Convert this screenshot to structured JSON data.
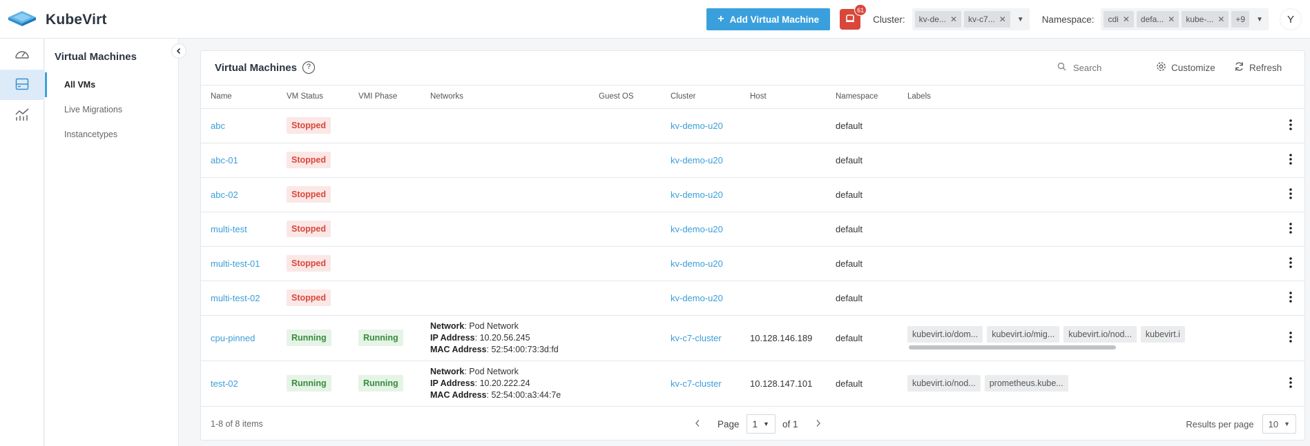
{
  "brand": {
    "name": "KubeVirt"
  },
  "topbar": {
    "add_vm_label": "Add Virtual Machine",
    "alerts_count": "61",
    "cluster_label": "Cluster:",
    "cluster_chips": [
      "kv-de...",
      "kv-c7..."
    ],
    "namespace_label": "Namespace:",
    "namespace_chips": [
      "cdi",
      "defa...",
      "kube-..."
    ],
    "namespace_more": "+9",
    "avatar_initial": "Y"
  },
  "subnav": {
    "title": "Virtual Machines",
    "items": [
      "All VMs",
      "Live Migrations",
      "Instancetypes"
    ]
  },
  "card": {
    "title": "Virtual Machines",
    "search_placeholder": "Search",
    "customize_label": "Customize",
    "refresh_label": "Refresh"
  },
  "table": {
    "columns": [
      "Name",
      "VM Status",
      "VMI Phase",
      "Networks",
      "Guest OS",
      "Cluster",
      "Host",
      "Namespace",
      "Labels"
    ],
    "rows": [
      {
        "name": "abc",
        "vm_status": "Stopped",
        "vmi_phase": "",
        "cluster": "kv-demo-u20",
        "host": "",
        "namespace": "default",
        "labels": []
      },
      {
        "name": "abc-01",
        "vm_status": "Stopped",
        "vmi_phase": "",
        "cluster": "kv-demo-u20",
        "host": "",
        "namespace": "default",
        "labels": []
      },
      {
        "name": "abc-02",
        "vm_status": "Stopped",
        "vmi_phase": "",
        "cluster": "kv-demo-u20",
        "host": "",
        "namespace": "default",
        "labels": []
      },
      {
        "name": "multi-test",
        "vm_status": "Stopped",
        "vmi_phase": "",
        "cluster": "kv-demo-u20",
        "host": "",
        "namespace": "default",
        "labels": []
      },
      {
        "name": "multi-test-01",
        "vm_status": "Stopped",
        "vmi_phase": "",
        "cluster": "kv-demo-u20",
        "host": "",
        "namespace": "default",
        "labels": []
      },
      {
        "name": "multi-test-02",
        "vm_status": "Stopped",
        "vmi_phase": "",
        "cluster": "kv-demo-u20",
        "host": "",
        "namespace": "default",
        "labels": []
      },
      {
        "name": "cpu-pinned",
        "vm_status": "Running",
        "vmi_phase": "Running",
        "network": {
          "network_key": "Network",
          "network": ": Pod Network",
          "ip_key": "IP Address",
          "ip": ": 10.20.56.245",
          "mac_key": "MAC Address",
          "mac": ": 52:54:00:73:3d:fd"
        },
        "cluster": "kv-c7-cluster",
        "host": "10.128.146.189",
        "namespace": "default",
        "labels": [
          "kubevirt.io/dom...",
          "kubevirt.io/mig...",
          "kubevirt.io/nod...",
          "kubevirt.i"
        ]
      },
      {
        "name": "test-02",
        "vm_status": "Running",
        "vmi_phase": "Running",
        "network": {
          "network_key": "Network",
          "network": ": Pod Network",
          "ip_key": "IP Address",
          "ip": ": 10.20.222.24",
          "mac_key": "MAC Address",
          "mac": ": 52:54:00:a3:44:7e"
        },
        "cluster": "kv-c7-cluster",
        "host": "10.128.147.101",
        "namespace": "default",
        "labels": [
          "kubevirt.io/nod...",
          "prometheus.kube..."
        ]
      }
    ]
  },
  "footer": {
    "count": "1-8 of 8 items",
    "page_label": "Page",
    "page_value": "1",
    "of_label": "of 1",
    "results_label": "Results per page",
    "results_value": "10"
  },
  "colors": {
    "accent": "#3aa0dd",
    "danger": "#d9473b",
    "success": "#3a8b3d"
  }
}
